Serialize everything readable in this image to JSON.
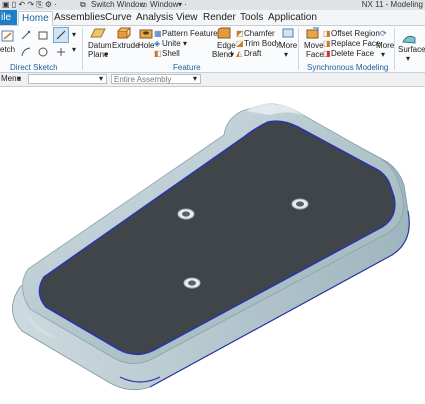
{
  "app": {
    "title": "NX 11 - Modeling",
    "switch_window": "Switch Window",
    "window_menu": "Window"
  },
  "tabs": [
    "ile",
    "Home",
    "Assemblies",
    "Curve",
    "Analysis",
    "View",
    "Render",
    "Tools",
    "Application"
  ],
  "ribbon": {
    "sketch": "etch",
    "datum_plane": "Datum",
    "datum_plane2": "Plane",
    "extrude": "Extrude",
    "hole": "Hole",
    "pattern_feature": "Pattern Feature",
    "unite": "Unite",
    "shell": "Shell",
    "edge_blend": "Edge",
    "edge_blend2": "Blend",
    "chamfer": "Chamfer",
    "trim_body": "Trim Body",
    "draft": "Draft",
    "more1": "More",
    "move_face": "Move",
    "move_face2": "Face",
    "offset_region": "Offset Region",
    "replace_face": "Replace Face",
    "delete_face": "Delete Face",
    "more2": "More",
    "surface": "Surface",
    "group_direct_sketch": "Direct Sketch",
    "group_feature": "Feature",
    "group_sync_modeling": "Synchronous Modeling"
  },
  "selection_bar": {
    "menu": "Menu",
    "filter_placeholder": "",
    "assembly": "Entire Assembly"
  },
  "colors": {
    "accent": "#1f7fc4",
    "part_top": "#3f4549",
    "part_rim": "#b9cbd2",
    "edge": "#2b35a8"
  }
}
